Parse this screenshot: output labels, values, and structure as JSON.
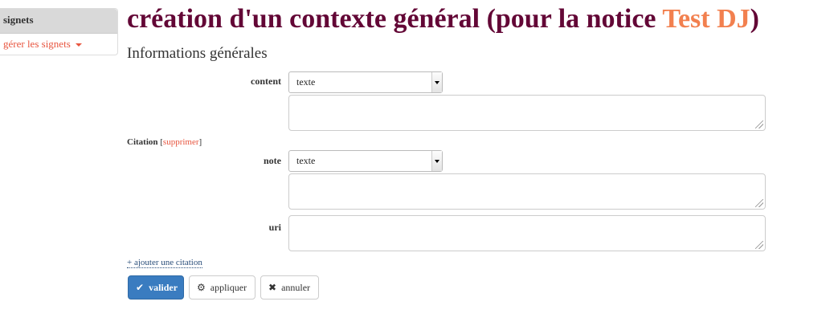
{
  "sidebar": {
    "header": "signets",
    "menu_label": "gérer les signets"
  },
  "page": {
    "title_prefix": "création d'un contexte général (pour la notice ",
    "title_highlight": "Test DJ",
    "title_suffix": ")",
    "section_title": "Informations générales"
  },
  "form": {
    "content": {
      "label": "content",
      "select_value": "texte",
      "text_value": ""
    },
    "citation": {
      "label": "Citation",
      "delete_bracket_open": "[",
      "delete_label": "supprimer",
      "delete_bracket_close": "]"
    },
    "note": {
      "label": "note",
      "select_value": "texte",
      "text_value": ""
    },
    "uri": {
      "label": "uri",
      "text_value": ""
    },
    "add_citation_label": "+ ajouter une citation"
  },
  "buttons": {
    "validate": "valider",
    "apply": "appliquer",
    "cancel": "annuler"
  },
  "colors": {
    "title": "#630736",
    "title_highlight": "#f2804f",
    "link": "#e8553f",
    "primary": "#3a7cc0"
  },
  "icons": {
    "validate": "check-icon",
    "apply": "cog-icon",
    "cancel": "close-icon",
    "menu": "caret-down-icon"
  }
}
